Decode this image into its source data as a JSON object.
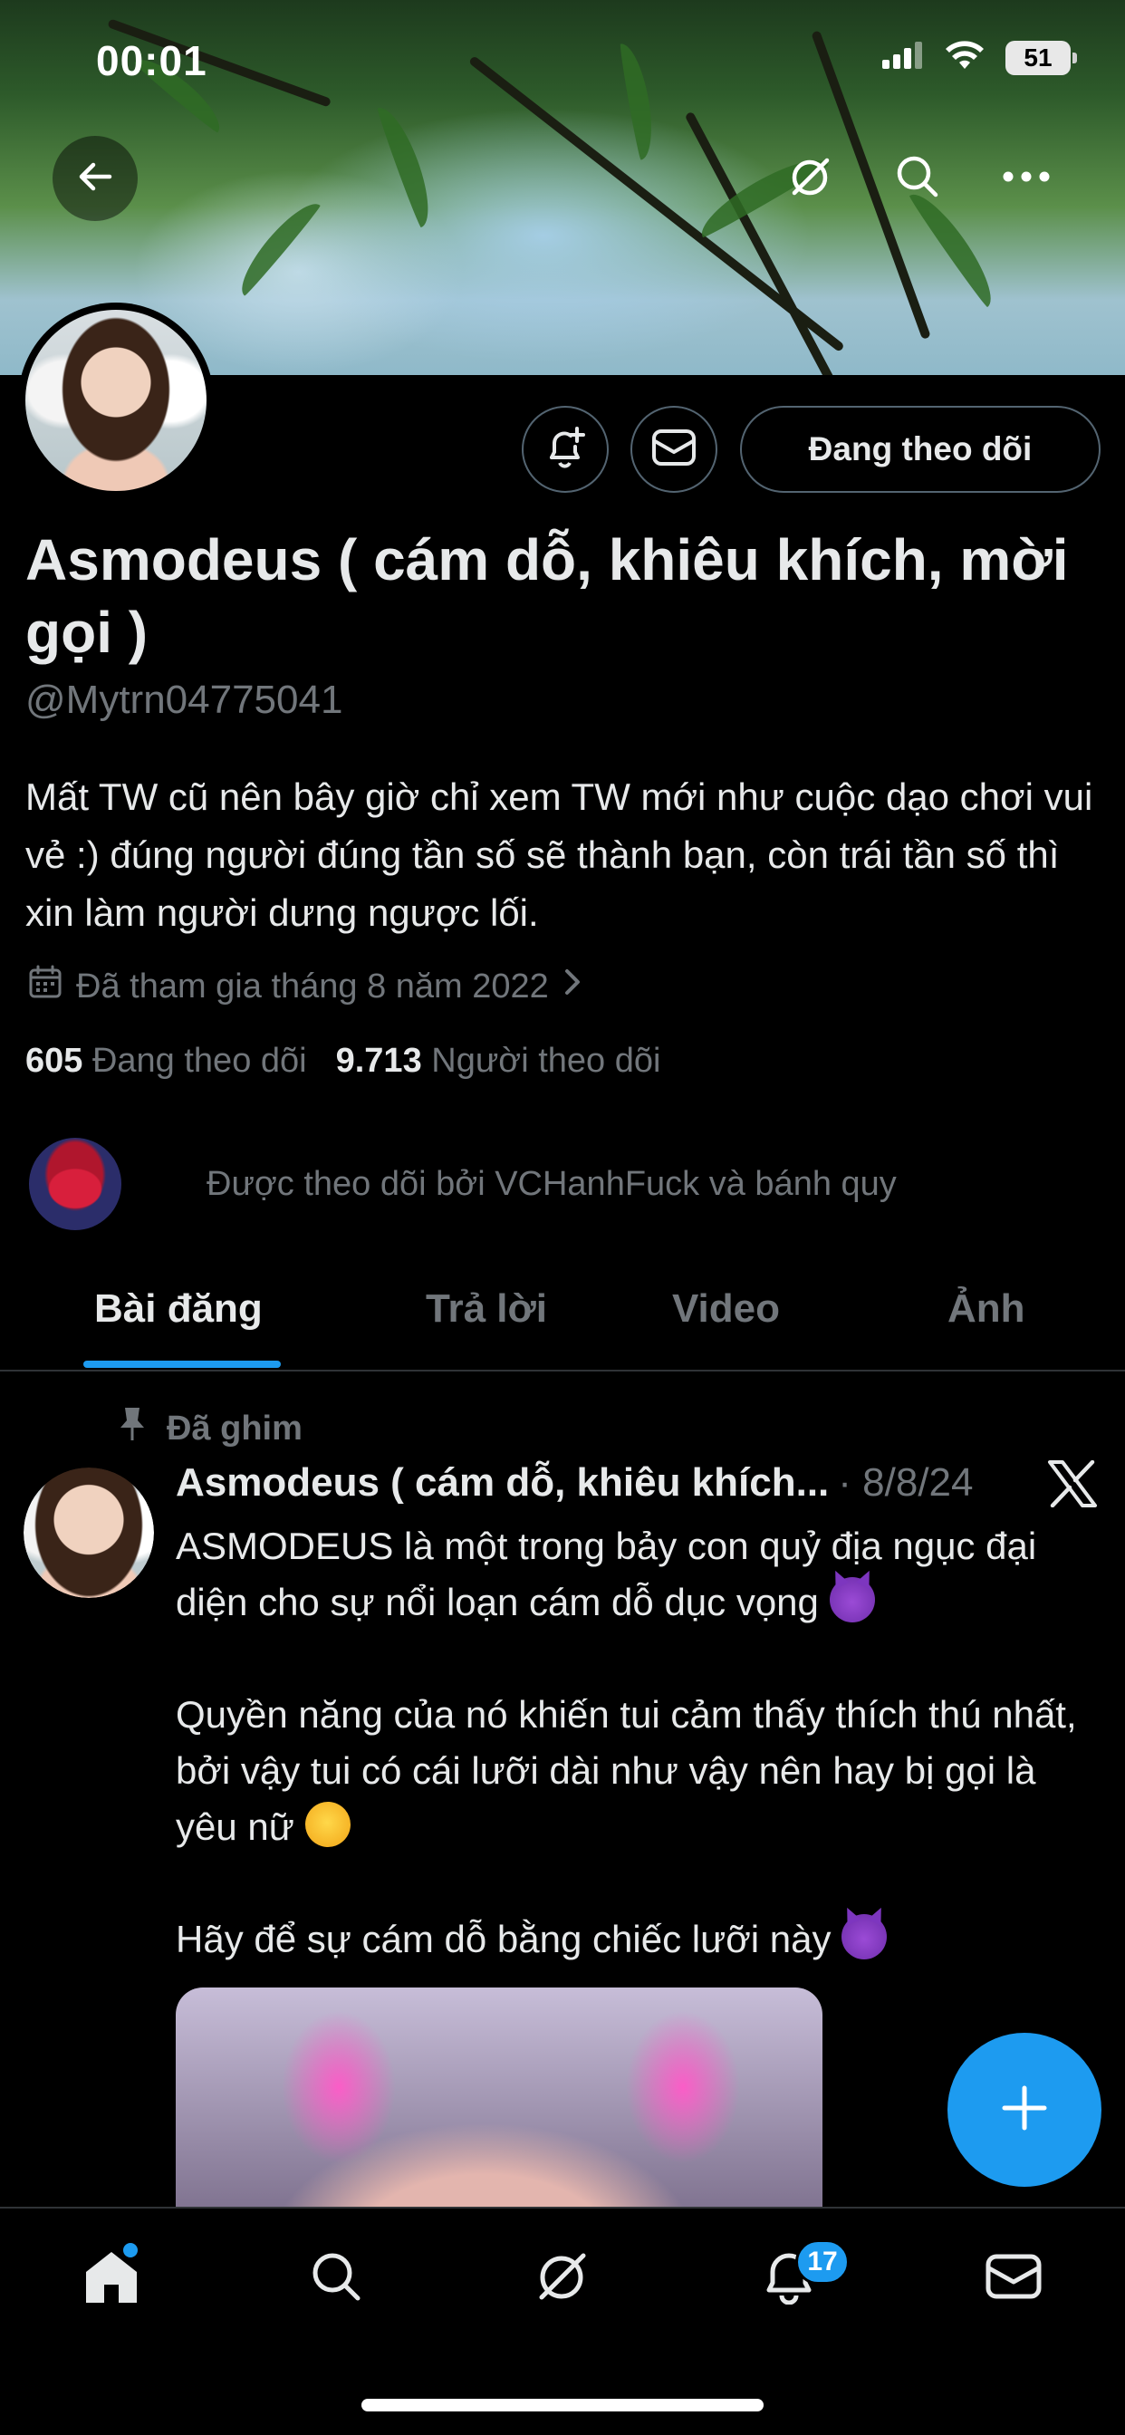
{
  "status_bar": {
    "time": "00:01",
    "battery": "51",
    "icons": [
      "signal-icon",
      "wifi-icon",
      "battery-icon"
    ]
  },
  "banner_toolbar": {
    "icons": [
      "back-arrow-icon",
      "grok-icon",
      "search-icon",
      "more-icon"
    ]
  },
  "profile": {
    "display_name": "Asmodeus ( cám dỗ, khiêu khích, mời gọi )",
    "handle": "@Mytrn04775041",
    "bio": "Mất TW cũ nên bây giờ chỉ xem TW mới như cuộc dạo chơi vui vẻ :) đúng người đúng tần số sẽ thành bạn, còn trái tần số thì xin làm người dưng ngược lối.",
    "joined": "Đã tham gia tháng 8 năm 2022",
    "following_count": "605",
    "following_label": "Đang theo dõi",
    "followers_count": "9.713",
    "followers_label": "Người theo dõi",
    "followed_by": "Được theo dõi bởi VCHanhFuck và bánh quy",
    "follow_button": "Đang theo dõi",
    "action_icons": [
      "notification-add-icon",
      "message-icon"
    ]
  },
  "tabs": [
    {
      "label": "Bài đăng",
      "active": true
    },
    {
      "label": "Trả lời",
      "active": false
    },
    {
      "label": "Video",
      "active": false
    },
    {
      "label": "Ảnh",
      "active": false
    }
  ],
  "pinned_post": {
    "pinned_label": "Đã ghim",
    "author": "Asmodeus ( cám dỗ, khiêu khích...",
    "date": "· 8/8/24",
    "para1": "ASMODEUS là một trong bảy con quỷ địa ngục đại diện cho sự nổi loạn cám dỗ dục vọng",
    "para2": "Quyền năng của nó khiến tui cảm thấy thích thú nhất, bởi vậy tui có cái lưỡi dài như vậy nên hay bị gọi là yêu nữ",
    "para3": "Hãy để sự cám dỗ bằng chiếc lưỡi này"
  },
  "fab": {
    "icon": "plus-icon"
  },
  "bottom_nav": {
    "items": [
      "home-icon",
      "search-icon",
      "grok-icon",
      "notifications-icon",
      "messages-icon"
    ],
    "notifications_badge": "17"
  },
  "colors": {
    "accent": "#1d9bf0",
    "background": "#000000",
    "secondary_text": "#71767b",
    "border": "#2f3336"
  }
}
